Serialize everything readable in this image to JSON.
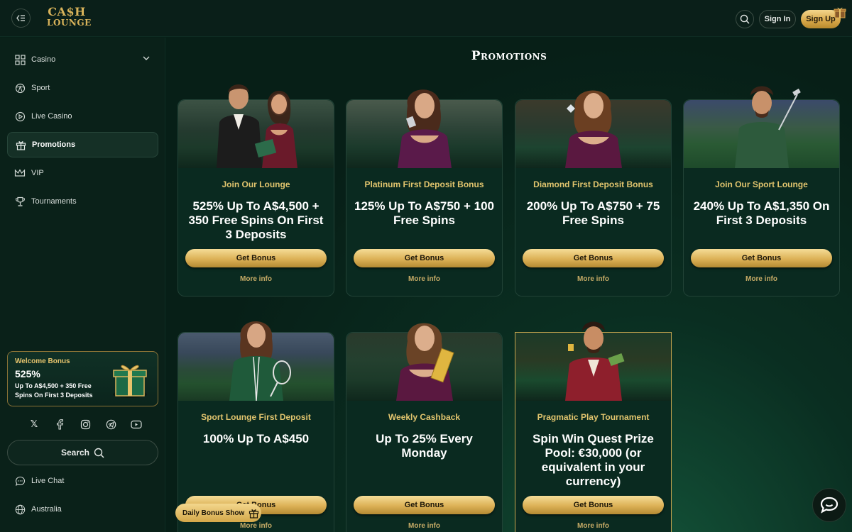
{
  "header": {
    "logo_line1": "CA$H",
    "logo_line2": "LOUNGE",
    "sign_in": "Sign In",
    "sign_up": "Sign Up"
  },
  "sidebar": {
    "items": [
      {
        "label": "Casino",
        "icon": "casino-grid-icon"
      },
      {
        "label": "Sport",
        "icon": "ball-icon"
      },
      {
        "label": "Live Casino",
        "icon": "play-icon"
      },
      {
        "label": "Promotions",
        "icon": "gift-icon",
        "active": true
      },
      {
        "label": "VIP",
        "icon": "crown-icon"
      },
      {
        "label": "Tournaments",
        "icon": "trophy-icon"
      }
    ],
    "welcome": {
      "title": "Welcome Bonus",
      "percent": "525%",
      "desc": "Up To A$4,500 + 350 Free Spins On First 3 Deposits"
    },
    "search_label": "Search",
    "footer": [
      {
        "label": "Live Chat",
        "icon": "chat-icon"
      },
      {
        "label": "Australia",
        "icon": "globe-icon"
      }
    ]
  },
  "main": {
    "title": "Promotions",
    "get_bonus": "Get Bonus",
    "more_info": "More info",
    "cards": [
      {
        "subtitle": "Join Our Lounge",
        "headline": "525% Up To A$4,500 + 350 Free Spins On First 3 Deposits"
      },
      {
        "subtitle": "Platinum First Deposit Bonus",
        "headline": "125% Up To A$750 + 100 Free Spins"
      },
      {
        "subtitle": "Diamond First Deposit Bonus",
        "headline": "200% Up To A$750 + 75 Free Spins"
      },
      {
        "subtitle": "Join Our Sport Lounge",
        "headline": "240% Up To A$1,350 On First 3 Deposits"
      },
      {
        "subtitle": "Sport Lounge First Deposit",
        "headline": "100% Up To A$450"
      },
      {
        "subtitle": "Weekly Cashback",
        "headline": "Up To 25% Every Monday"
      },
      {
        "subtitle": "Pragmatic Play Tournament",
        "headline": "Spin Win Quest Prize Pool: €30,000 (or equivalent in your currency)"
      }
    ]
  },
  "floating": {
    "daily_bonus": "Daily Bonus Show"
  },
  "colors": {
    "gold": "#d8b35a",
    "background": "#071f17",
    "card": "#0a2a20"
  }
}
